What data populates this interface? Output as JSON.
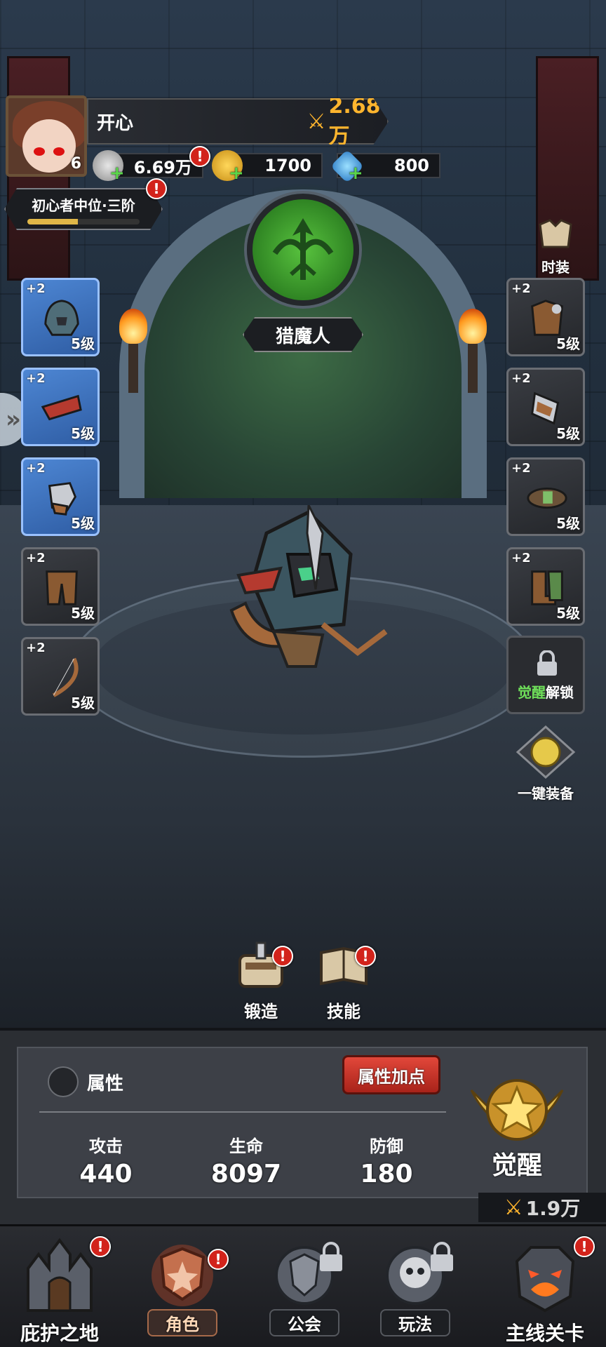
{
  "player": {
    "name": "开心",
    "level": "6",
    "power": "2.68万"
  },
  "currencies": {
    "silver": "6.69万",
    "gold": "1700",
    "gems": "800"
  },
  "rank": {
    "title": "初心者中位·三阶",
    "progress": 0.45
  },
  "hero_class": "猎魔人",
  "costume_label": "时装",
  "equipment": {
    "left": [
      {
        "bonus": "+2",
        "level": "5级",
        "item": "helmet-icon",
        "rarity": "blue"
      },
      {
        "bonus": "+2",
        "level": "5级",
        "item": "scarf-icon",
        "rarity": "blue"
      },
      {
        "bonus": "+2",
        "level": "5级",
        "item": "gauntlet-icon",
        "rarity": "blue"
      },
      {
        "bonus": "+2",
        "level": "5级",
        "item": "pants-icon",
        "rarity": "grey"
      },
      {
        "bonus": "+2",
        "level": "5级",
        "item": "bow-icon",
        "rarity": "grey"
      }
    ],
    "right": [
      {
        "bonus": "+2",
        "level": "5级",
        "item": "armor-icon",
        "rarity": "grey"
      },
      {
        "bonus": "+2",
        "level": "5级",
        "item": "bracer-icon",
        "rarity": "grey"
      },
      {
        "bonus": "+2",
        "level": "5级",
        "item": "belt-icon",
        "rarity": "grey"
      },
      {
        "bonus": "+2",
        "level": "5级",
        "item": "boots-icon",
        "rarity": "grey"
      }
    ],
    "locked_slot": {
      "highlight": "觉醒",
      "rest": "解锁"
    },
    "auto_equip_label": "一键装备"
  },
  "actions": {
    "forge": "锻造",
    "skills": "技能"
  },
  "attributes": {
    "title": "属性",
    "add_points_label": "属性加点",
    "stats": [
      {
        "label": "攻击",
        "value": "440"
      },
      {
        "label": "生命",
        "value": "8097"
      },
      {
        "label": "防御",
        "value": "180"
      }
    ],
    "awaken_label": "觉醒",
    "awaken_power": "1.9万"
  },
  "nav": {
    "sanctuary": "庇护之地",
    "character": "角色",
    "guild": "公会",
    "gameplay": "玩法",
    "main_stage": "主线关卡"
  },
  "colors": {
    "accent_gold": "#ffb52e",
    "badge_red": "#d2231b",
    "class_green": "#58c23e",
    "rare_blue": "#4d86d3"
  }
}
